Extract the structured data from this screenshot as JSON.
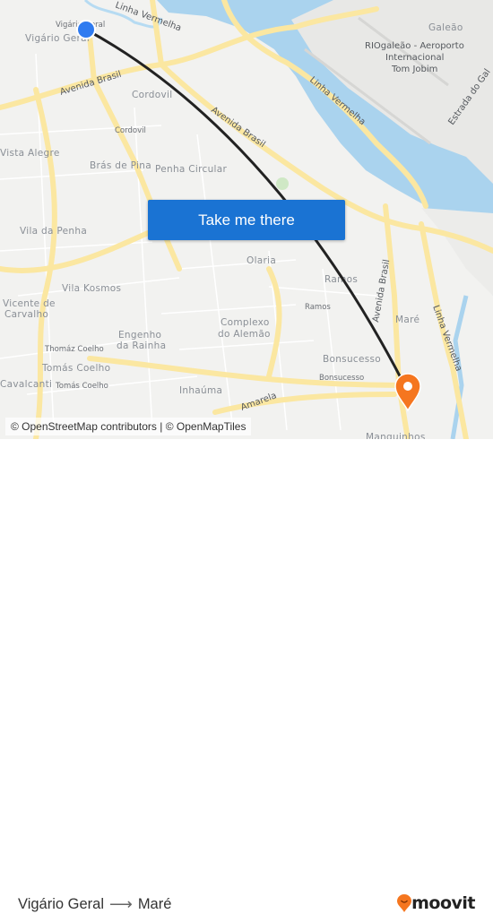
{
  "map": {
    "origin_label": "Vigário Geral",
    "labels": {
      "vigario_geral_station": "Vigário Geral",
      "vigario_geral": "Vigário Geral",
      "linha_vermelha_top": "Linha Vermelha",
      "avenida_brasil_left": "Avenida Brasil",
      "cordovil": "Cordovil",
      "cordovil_station": "Cordovil",
      "avenida_brasil_mid": "Avenida Brasil",
      "vista_alegre": "Vista Alegre",
      "bras_de_pina": "Brás de Pina",
      "penha_circular": "Penha Circular",
      "penha": "Penha",
      "vila_da_penha": "Vila da Penha",
      "vila_kosmos": "Vila Kosmos",
      "vicente_de_carvalho_1": "Vicente de",
      "vicente_de_carvalho_2": "Carvalho",
      "engenho_1": "Engenho",
      "engenho_2": "da Rainha",
      "complexo_1": "Complexo",
      "complexo_2": "do Alemão",
      "olaria": "Olaria",
      "ramos": "Ramos",
      "ramos_station": "Ramos",
      "bonsucesso": "Bonsucesso",
      "bonsucesso_station": "Bonsucesso",
      "thomaz_coelho_station": "Thomáz Coelho",
      "tomas_coelho": "Tomás Coelho",
      "tomas_coelho_station": "Tomás Coelho",
      "cavalcanti": "Cavalcanti",
      "inhauma": "Inhaúma",
      "amarela": "Amarela",
      "manguinhos": "Manguinhos",
      "mare": "Maré",
      "galeao": "Galeão",
      "airport_1": "RIOgaleão - Aeroporto",
      "airport_2": "Internacional",
      "airport_3": "Tom Jobim",
      "linha_vermelha_mid": "Linha Vermelha",
      "linha_vermelha_right": "Linha Vermelha",
      "avenida_brasil_right": "Avenida Brasil",
      "estrada_do_galeao": "Estrada do Gal"
    },
    "colors": {
      "water": "#aad3ee",
      "route": "#222222",
      "origin": "#2f7bf0",
      "destination": "#f5761f"
    }
  },
  "cta": {
    "label": "Take me there"
  },
  "attribution": "© OpenStreetMap contributors | © OpenMapTiles",
  "footer": {
    "from": "Vigário Geral",
    "arrow": "⟶",
    "to": "Maré",
    "brand": "moovit",
    "brand_color": "#f5761f"
  }
}
